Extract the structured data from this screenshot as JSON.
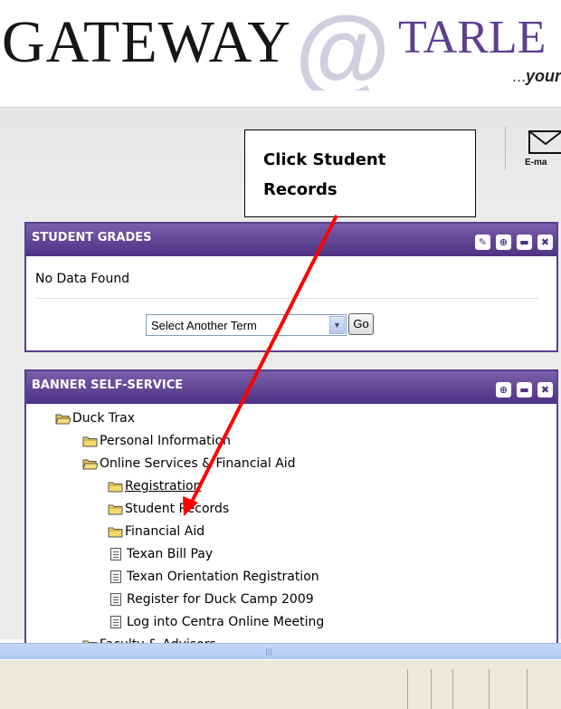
{
  "header": {
    "logo_main": "GATEWAY",
    "logo_at": "@",
    "logo_brand": "TARLE",
    "tagline_dots": "...",
    "tagline": "your"
  },
  "toolbar": {
    "email_label": "E-ma",
    "email_icon": "envelope-icon"
  },
  "callout": {
    "line1": "Click Student",
    "line2": "Records"
  },
  "student_grades": {
    "title": "STUDENT GRADES",
    "icons": [
      "edit-icon",
      "target-icon",
      "minimize-icon",
      "close-icon"
    ],
    "icon_glyphs": [
      "✎",
      "⊕",
      "▬",
      "✖"
    ],
    "no_data": "No Data Found",
    "term_select_value": "Select Another Term",
    "go_label": "Go"
  },
  "banner": {
    "title": "BANNER SELF-SERVICE",
    "icons": [
      "target-icon",
      "minimize-icon",
      "close-icon"
    ],
    "icon_glyphs": [
      "⊕",
      "▬",
      "✖"
    ],
    "tree": [
      {
        "label": "Duck Trax",
        "type": "folder-open"
      },
      {
        "label": "Personal Information",
        "type": "folder"
      },
      {
        "label": "Online Services & Financial Aid",
        "type": "folder-open"
      },
      {
        "label": "Registration",
        "type": "folder",
        "link": true
      },
      {
        "label": "Student Records",
        "type": "folder"
      },
      {
        "label": "Financial Aid",
        "type": "folder"
      },
      {
        "label": "Texan Bill Pay",
        "type": "doc"
      },
      {
        "label": "Texan Orientation Registration",
        "type": "doc"
      },
      {
        "label": "Register for Duck Camp 2009",
        "type": "doc"
      },
      {
        "label": "Log into Centra Online Meeting",
        "type": "doc"
      },
      {
        "label": "Faculty & Advisors",
        "type": "folder"
      }
    ]
  },
  "colors": {
    "portlet_header": "#5b3f8c",
    "brand_purple": "#5d3f8f",
    "folder_yellow": "#f5d96a",
    "arrow_red": "#ff0000"
  }
}
